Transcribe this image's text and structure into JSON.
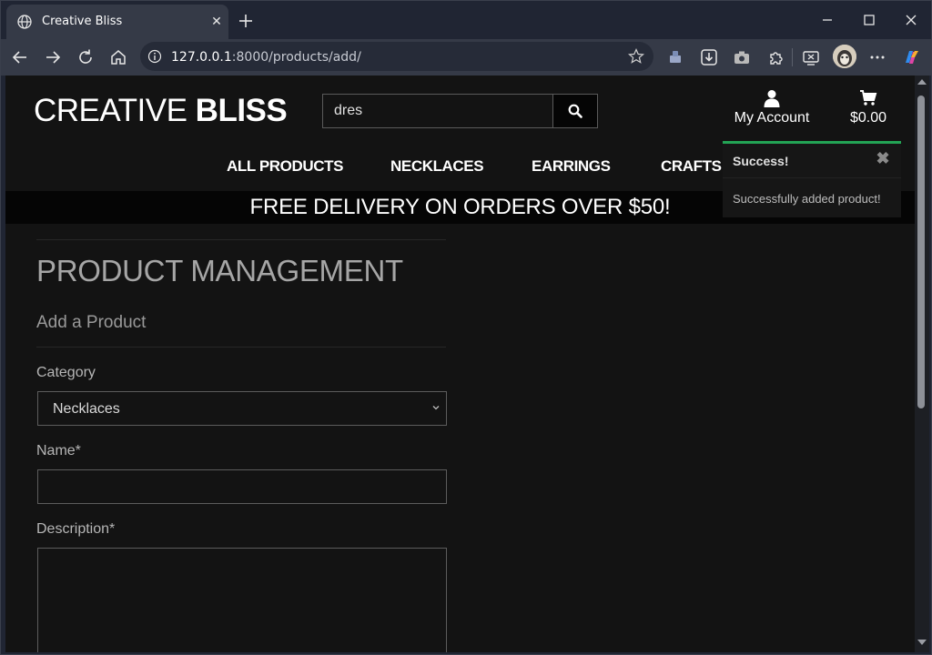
{
  "browser": {
    "tab_title": "Creative Bliss",
    "tab_close": "✕",
    "url_host": "127.0.0.1",
    "url_path": ":8000/products/add/"
  },
  "site": {
    "brand_regular": "CREATIVE",
    "brand_bold": "BLISS",
    "search_value": "dres",
    "account_label": "My Account",
    "cart_total": "$0.00",
    "nav": [
      "ALL PRODUCTS",
      "NECKLACES",
      "EARRINGS",
      "CRAFTS"
    ],
    "banner": "FREE DELIVERY ON ORDERS OVER $50!"
  },
  "toast": {
    "title": "Success!",
    "close": "✖",
    "message": "Successfully added product!",
    "accent": "#23a455"
  },
  "form": {
    "page_title": "PRODUCT MANAGEMENT",
    "subtitle": "Add a Product",
    "category_label": "Category",
    "category_value": "Necklaces",
    "name_label": "Name*",
    "name_value": "",
    "description_label": "Description*",
    "description_value": ""
  },
  "colors": {
    "page_bg": "#131313",
    "chrome_bg": "#353a47"
  }
}
